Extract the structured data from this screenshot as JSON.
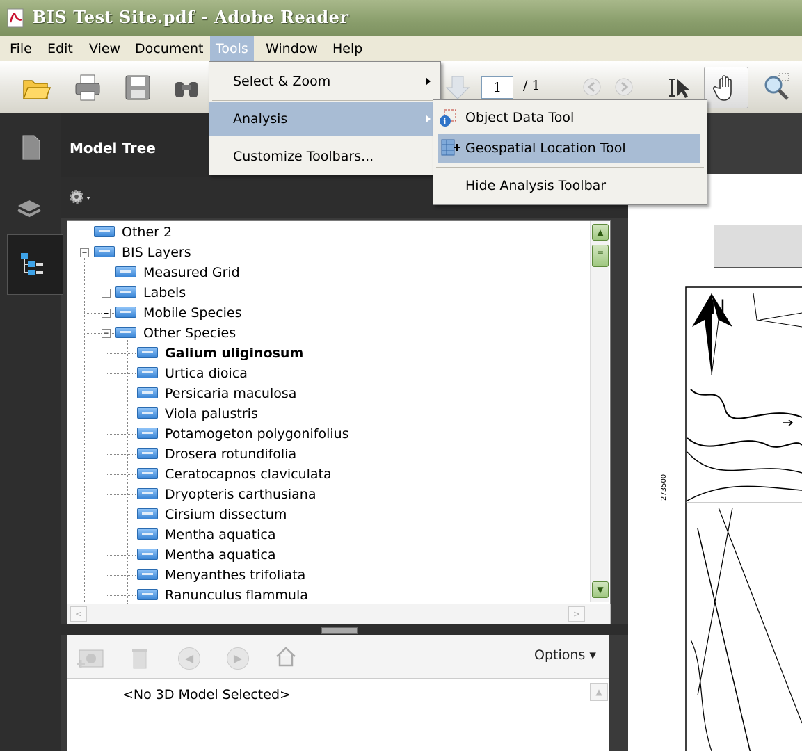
{
  "window": {
    "title": "BIS Test Site.pdf - Adobe Reader"
  },
  "menubar": {
    "items": [
      "File",
      "Edit",
      "View",
      "Document",
      "Tools",
      "Window",
      "Help"
    ],
    "active": "Tools"
  },
  "toolbar": {
    "page_current": "1",
    "page_total": "/ 1"
  },
  "tools_menu": {
    "items": [
      {
        "label": "Select & Zoom",
        "has_submenu": true
      },
      {
        "label": "Analysis",
        "has_submenu": true,
        "highlighted": true
      },
      {
        "label": "Customize Toolbars...",
        "has_submenu": false
      }
    ]
  },
  "analysis_submenu": {
    "items": [
      {
        "label": "Object Data Tool",
        "icon": "object-data-icon"
      },
      {
        "label": "Geospatial Location Tool",
        "icon": "geospatial-location-icon",
        "highlighted": true
      },
      {
        "label": "Hide Analysis Toolbar"
      }
    ]
  },
  "panel": {
    "title": "Model Tree",
    "options_label": "Options ▾",
    "no_model_text": "<No 3D Model Selected>"
  },
  "tree": {
    "nodes": [
      {
        "label": "Other 2",
        "level": 0
      },
      {
        "label": "BIS Layers",
        "level": 0,
        "expander": "−"
      },
      {
        "label": "Measured Grid",
        "level": 1
      },
      {
        "label": "Labels",
        "level": 1,
        "expander": "+"
      },
      {
        "label": "Mobile Species",
        "level": 1,
        "expander": "+"
      },
      {
        "label": "Other Species",
        "level": 1,
        "expander": "−"
      },
      {
        "label": "Galium uliginosum",
        "level": 2,
        "bold": true
      },
      {
        "label": "Urtica dioica",
        "level": 2
      },
      {
        "label": "Persicaria maculosa",
        "level": 2
      },
      {
        "label": "Viola palustris",
        "level": 2
      },
      {
        "label": "Potamogeton polygonifolius",
        "level": 2
      },
      {
        "label": "Drosera rotundifolia",
        "level": 2
      },
      {
        "label": "Ceratocapnos claviculata",
        "level": 2
      },
      {
        "label": "Dryopteris carthusiana",
        "level": 2
      },
      {
        "label": "Cirsium dissectum",
        "level": 2
      },
      {
        "label": "Mentha aquatica",
        "level": 2
      },
      {
        "label": "Mentha aquatica",
        "level": 2
      },
      {
        "label": "Menyanthes trifoliata",
        "level": 2
      },
      {
        "label": "Ranunculus flammula",
        "level": 2
      }
    ]
  },
  "map": {
    "north_label": "N",
    "grid_label": "273500"
  },
  "colors": {
    "titlebar": "#8a9e6c",
    "menu_highlight": "#a8bcd4",
    "layer_icon": "#3b86d6"
  }
}
